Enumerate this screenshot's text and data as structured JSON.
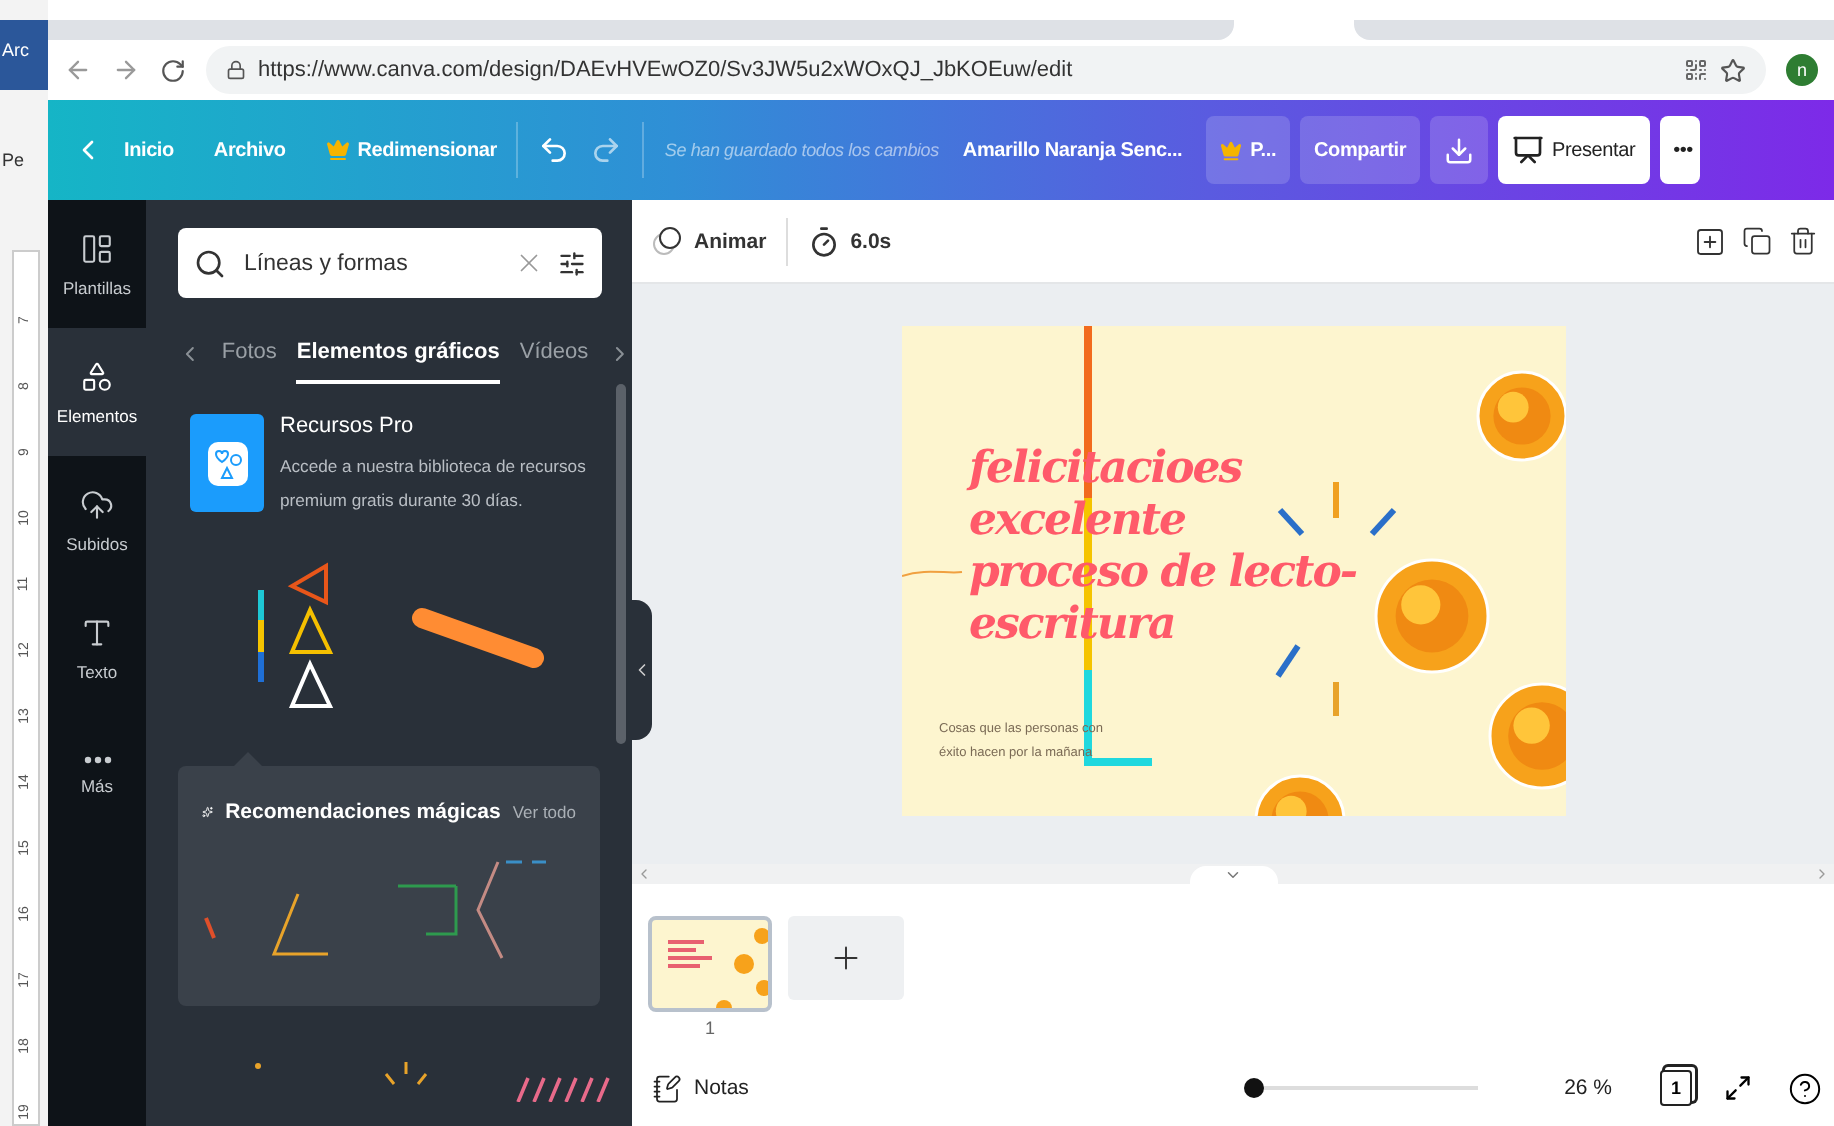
{
  "background_window": {
    "title_fragment": "Arc",
    "label_fragment": "Pe",
    "ruler": [
      "7",
      "8",
      "9",
      "10",
      "11",
      "12",
      "13",
      "14",
      "15",
      "16",
      "17",
      "18",
      "19"
    ]
  },
  "browser": {
    "url": "https://www.canva.com/design/DAEvHVEwOZ0/Sv3JW5u2xWOxQJ_JbKOEuw/edit",
    "profile_initial": "n"
  },
  "header": {
    "back": "Inicio",
    "menu": "Archivo",
    "resize": "Redimensionar",
    "status": "Se han guardado todos los cambios",
    "design_title": "Amarillo Naranja Senc...",
    "pro": "P...",
    "share": "Compartir",
    "present": "Presentar",
    "more": "•••"
  },
  "sidebar": {
    "items": [
      {
        "label": "Plantillas",
        "selected": false
      },
      {
        "label": "Elementos",
        "selected": true
      },
      {
        "label": "Subidos",
        "selected": false
      },
      {
        "label": "Texto",
        "selected": false
      },
      {
        "label": "Más",
        "selected": false
      }
    ]
  },
  "panel": {
    "search": {
      "value": "Líneas y formas"
    },
    "tabs": [
      {
        "label": "Fotos",
        "selected": false
      },
      {
        "label": "Elementos gráficos",
        "selected": true
      },
      {
        "label": "Vídeos",
        "selected": false
      }
    ],
    "promo": {
      "title": "Recursos Pro",
      "lines": [
        "Accede a nuestra biblioteca de recursos",
        "premium gratis durante 30 días."
      ]
    },
    "magic": {
      "title": "Recomendaciones mágicas",
      "link": "Ver todo"
    }
  },
  "toolbar": {
    "animate": "Animar",
    "duration": "6.0s"
  },
  "slide": {
    "title_lines": [
      "felicitacioes",
      "excelente",
      "proceso de lecto-",
      "escritura"
    ],
    "subtitle_lines": [
      "Cosas que las personas con",
      "éxito hacen por la mañana"
    ]
  },
  "pages": [
    {
      "number": "1",
      "selected": true
    }
  ],
  "footer": {
    "notes": "Notas",
    "zoom": {
      "level": 0.0,
      "reading": "26 %"
    },
    "page_count": "1"
  }
}
